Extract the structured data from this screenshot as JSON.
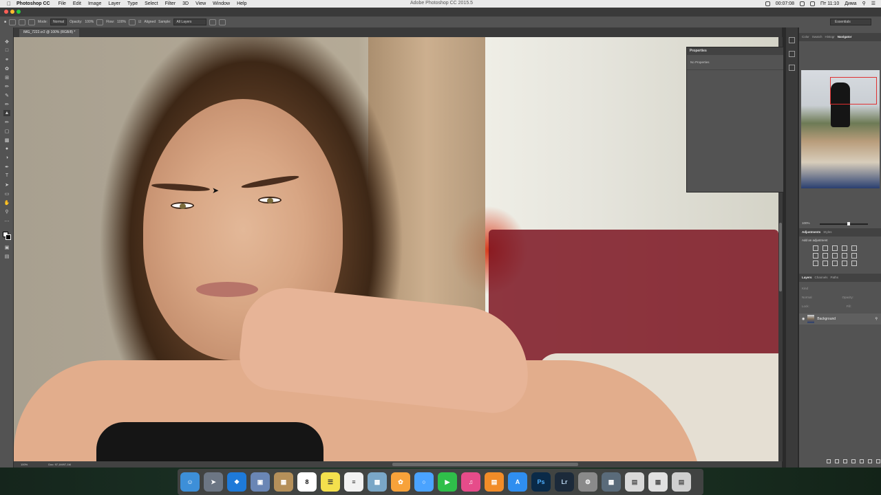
{
  "menubar": {
    "app": "Photoshop CC",
    "items": [
      "File",
      "Edit",
      "Image",
      "Layer",
      "Type",
      "Select",
      "Filter",
      "3D",
      "View",
      "Window",
      "Help"
    ],
    "window_title": "Adobe Photoshop CC 2015.5",
    "recording_time": "00:07:08",
    "clock": "Пт 11:10",
    "user": "Дима"
  },
  "options": {
    "mode_label": "Mode:",
    "mode_value": "Normal",
    "opacity_label": "Opacity:",
    "opacity_value": "100%",
    "flow_label": "Flow:",
    "flow_value": "100%",
    "aligned_label": "Aligned",
    "sample_label": "Sample:",
    "sample_value": "All Layers",
    "workspace": "Essentials"
  },
  "document": {
    "tab_title": "IMG_7222.cr2 @ 100% (RGB/8) *",
    "zoom": "100%",
    "doc_size": "Doc: 97,1M/97,1M"
  },
  "properties": {
    "title": "Properties",
    "empty": "No Properties"
  },
  "panels": {
    "top_tabs": [
      "Color",
      "Swatch",
      "Histogr",
      "Navigator"
    ],
    "navigator_zoom": "100%",
    "adj_tabs": [
      "Adjustments",
      "Styles"
    ],
    "adj_hint": "Add an adjustment",
    "layer_tabs": [
      "Layers",
      "Channels",
      "Paths"
    ],
    "kind_placeholder": "Kind",
    "blend": "Normal",
    "opacity_label": "Opacity:",
    "lock_label": "Lock:",
    "fill_label": "Fill:",
    "layer_name": "Background"
  },
  "dock": {
    "items": [
      "Finder",
      "Launchpad",
      "Safari",
      "Preview",
      "Notes",
      "Calendar",
      "Stickies",
      "Reminders",
      "Photo Booth",
      "Photos",
      "Messages",
      "FaceTime",
      "iTunes",
      "iBooks",
      "App Store",
      "Ps",
      "Lr",
      "System Preferences",
      "Screen",
      "Document",
      "Archive",
      "Trash"
    ],
    "calendar_day": "8"
  },
  "colors": {
    "panel_bg": "#535353",
    "panel_dark": "#424242",
    "accent_ps": "#0a2a48",
    "accent_lr": "#1c2a3a"
  }
}
